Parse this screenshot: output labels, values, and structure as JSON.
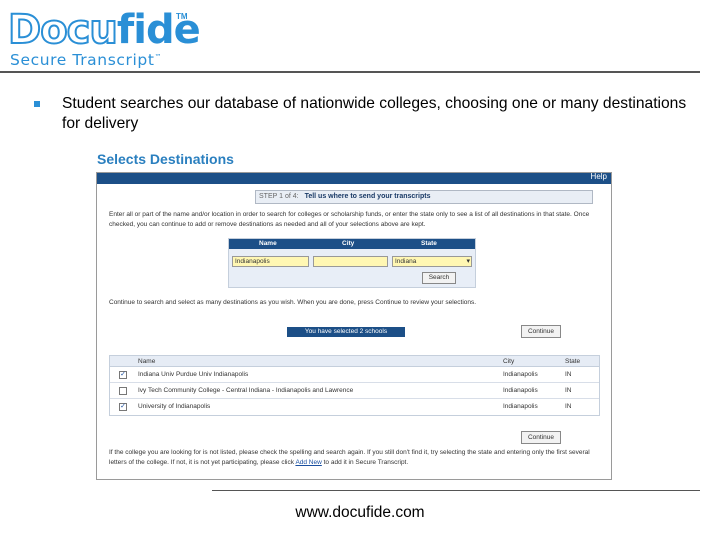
{
  "logo": {
    "word_part1": "Docu",
    "word_part2": "fide",
    "tm": "TM",
    "subtitle": "Secure Transcript",
    "subtitle_tm": "™"
  },
  "bullet": {
    "text": "Student searches our database of nationwide colleges, choosing one or many destinations for delivery"
  },
  "section_title": "Selects Destinations",
  "app": {
    "help": "Help",
    "step": {
      "number": "STEP 1 of 4:",
      "text": "Tell us where to send your transcripts"
    },
    "instructions": "Enter all or part of the name and/or location in order to search for colleges or scholarship funds, or enter the state only to see a list of all destinations in that state. Once checked, you can continue to add or remove destinations as needed and all of your selections above are kept.",
    "search": {
      "name_label": "Name",
      "city_label": "City",
      "state_label": "State",
      "name_value": "Indianapolis",
      "city_value": "",
      "state_value": "Indiana",
      "search_button": "Search"
    },
    "continue_instructions": "Continue to search and select as many destinations as you wish. When you are done, press Continue to review your selections.",
    "selected_count": "You have selected 2 schools",
    "continue_button": "Continue",
    "results": {
      "columns": [
        "Name",
        "City",
        "State"
      ],
      "rows": [
        {
          "checked": true,
          "name": "Indiana Univ Purdue Univ Indianapolis",
          "city": "Indianapolis",
          "state": "IN"
        },
        {
          "checked": false,
          "name": "Ivy Tech Community College - Central Indiana - Indianapolis and Lawrence",
          "city": "Indianapolis",
          "state": "IN"
        },
        {
          "checked": true,
          "name": "University of Indianapolis",
          "city": "Indianapolis",
          "state": "IN"
        }
      ]
    },
    "footnote_text": "If the college you are looking for is not listed, please check the spelling and search again. If you still don't find it, try selecting the state and entering only the first several letters of the college. If not, it is not yet participating, please click",
    "footnote_link": "Add New",
    "footnote_tail": "to add it in Secure Transcript."
  },
  "footer_url": "www.docufide.com"
}
